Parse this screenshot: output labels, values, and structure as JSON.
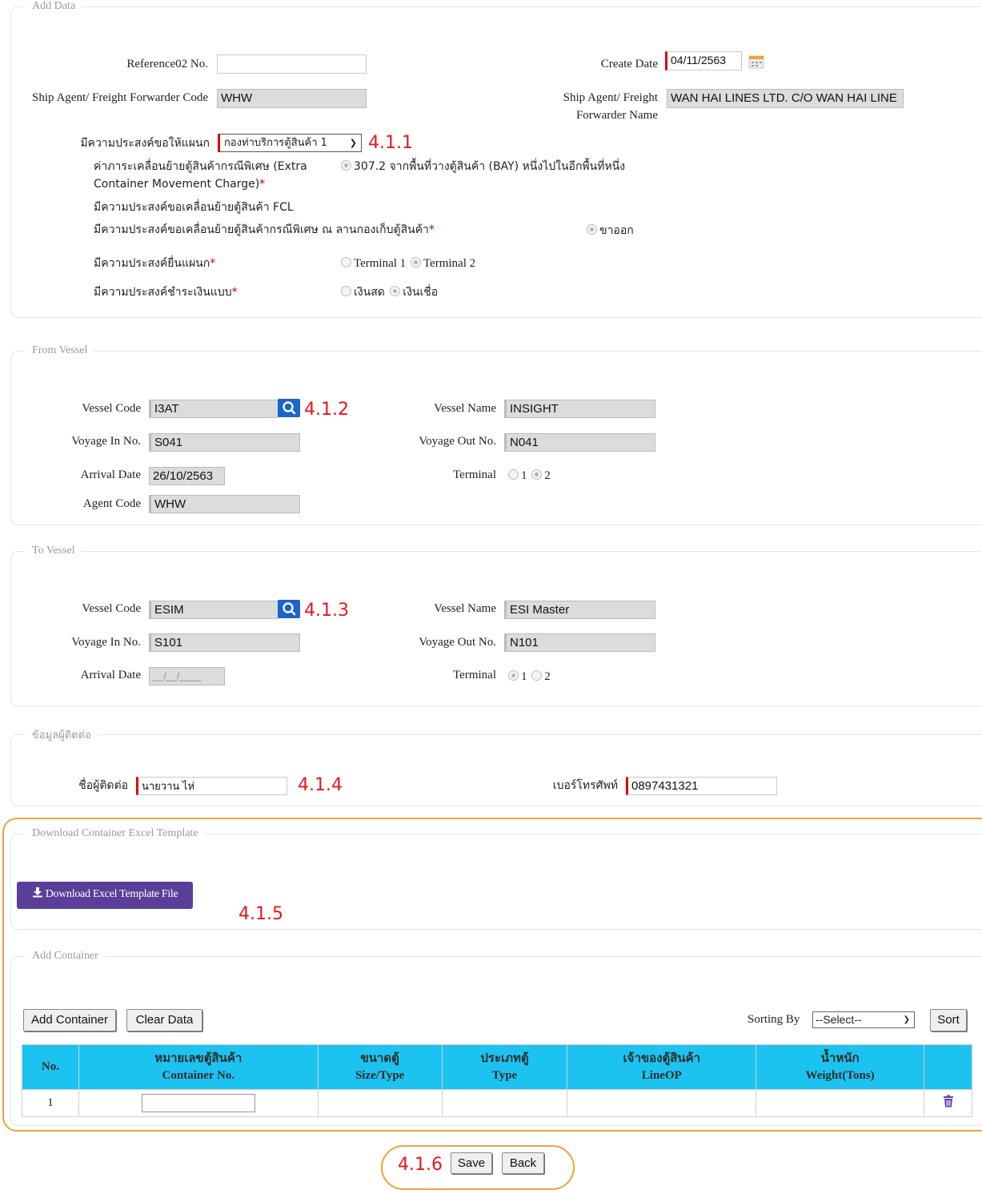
{
  "add_data": {
    "legend": "Add Data",
    "reference_label": "Reference02 No.",
    "reference_value": "",
    "create_date_label": "Create Date",
    "create_date_value": "04/11/2563",
    "agent_code_label": "Ship Agent/ Freight Forwarder Code",
    "agent_code_value": "WHW",
    "agent_name_label": "Ship Agent/ Freight Forwarder Name",
    "agent_name_value": "WAN HAI LINES LTD. C/O WAN HAI LINE",
    "dept_label": "มีความประสงค์ขอให้แผนก",
    "dept_value": "กองท่าบริการตู้สินค้า 1",
    "charge_label": "ค่าภาระเคลื่อนย้ายตู้สินค้ากรณีพิเศษ (Extra Container Movement Charge)",
    "charge_option": "307.2 จากพื้นที่วางตู้สินค้า (BAY) หนึ่งไปในอีกพื้นที่หนึ่ง",
    "fcl_label": "มีความประสงค์ขอเคลื่อนย้ายตู้สินค้า FCL",
    "special_move_label": "มีความประสงค์ขอเคลื่อนย้ายตู้สินค้ากรณีพิเศษ ณ ลานกองเก็บตู้สินค้า",
    "special_move_option": "ขาออก",
    "terminal_label": "มีความประสงค์ยื่นแผนก",
    "terminal_opt1": "Terminal 1",
    "terminal_opt2": "Terminal 2",
    "payment_label": "มีความประสงค์ชำระเงินแบบ",
    "payment_opt1": "เงินสด",
    "payment_opt2": "เงินเชื่อ",
    "required_mark": "*"
  },
  "from_vessel": {
    "legend": "From Vessel",
    "vessel_code_label": "Vessel Code",
    "vessel_code_value": "I3AT",
    "vessel_name_label": "Vessel Name",
    "vessel_name_value": "INSIGHT",
    "voyage_in_label": "Voyage In No.",
    "voyage_in_value": "S041",
    "voyage_out_label": "Voyage Out No.",
    "voyage_out_value": "N041",
    "arrival_label": "Arrival Date",
    "arrival_value": "26/10/2563",
    "terminal_label": "Terminal",
    "terminal_opt1": "1",
    "terminal_opt2": "2",
    "agent_code_label": "Agent Code",
    "agent_code_value": "WHW"
  },
  "to_vessel": {
    "legend": "To Vessel",
    "vessel_code_label": "Vessel Code",
    "vessel_code_value": "ESIM",
    "vessel_name_label": "Vessel Name",
    "vessel_name_value": "ESI Master",
    "voyage_in_label": "Voyage In No.",
    "voyage_in_value": "S101",
    "voyage_out_label": "Voyage Out No.",
    "voyage_out_value": "N101",
    "arrival_label": "Arrival Date",
    "arrival_value": "__/__/____",
    "terminal_label": "Terminal",
    "terminal_opt1": "1",
    "terminal_opt2": "2"
  },
  "contact": {
    "legend": "ข้อมูลผู้ติดต่อ",
    "name_label": "ชื่อผู้ติดต่อ",
    "name_value": "นายวาน ไห่",
    "phone_label": "เบอร์โทรศัพท์",
    "phone_value": "0897431321"
  },
  "download": {
    "legend": "Download Container Excel Template",
    "button_label": "Download Excel Template File"
  },
  "add_container": {
    "legend": "Add Container",
    "add_button": "Add Container",
    "clear_button": "Clear Data",
    "sorting_label": "Sorting By",
    "sort_select_value": "--Select--",
    "sort_button": "Sort",
    "columns": [
      {
        "th": "No.",
        "en": ""
      },
      {
        "th": "หมายเลขตู้สินค้า",
        "en": "Container No."
      },
      {
        "th": "ขนาดตู้",
        "en": "Size/Type"
      },
      {
        "th": "ประเภทตู้",
        "en": "Type"
      },
      {
        "th": "เจ้าของตู้สินค้า",
        "en": "LineOP"
      },
      {
        "th": "น้ำหนัก",
        "en": "Weight(Tons)"
      },
      {
        "th": "",
        "en": ""
      }
    ],
    "rows": [
      {
        "no": "1",
        "container_no": "",
        "size": "",
        "type": "",
        "lineop": "",
        "weight": ""
      }
    ]
  },
  "footer": {
    "save_button": "Save",
    "back_button": "Back"
  },
  "annotations": {
    "a411": "4.1.1",
    "a412": "4.1.2",
    "a413": "4.1.3",
    "a414": "4.1.4",
    "a415": "4.1.5",
    "a416": "4.1.6"
  },
  "icons": {
    "calendar": "calendar-icon",
    "search": "search-icon",
    "download": "download-icon",
    "trash": "trash-icon"
  },
  "colors": {
    "header_cyan": "#1dc3f0",
    "download_purple": "#5b3d9a",
    "annotation_red": "#e8161d",
    "highlight_orange": "#f0a23a",
    "search_blue": "#1b64c8",
    "required_red": "#c00000"
  }
}
